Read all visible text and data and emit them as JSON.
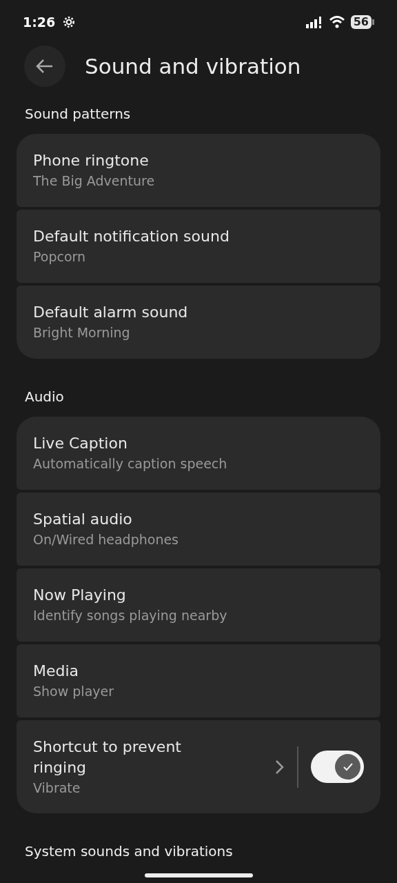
{
  "status_bar": {
    "time": "1:26",
    "battery": "56"
  },
  "header": {
    "title": "Sound and vibration"
  },
  "sections": [
    {
      "title": "Sound patterns",
      "items": [
        {
          "kind": "link",
          "title": "Phone ringtone",
          "subtitle": "The Big Adventure"
        },
        {
          "kind": "link",
          "title": "Default notification sound",
          "subtitle": "Popcorn"
        },
        {
          "kind": "link",
          "title": "Default alarm sound",
          "subtitle": "Bright Morning"
        }
      ]
    },
    {
      "title": "Audio",
      "items": [
        {
          "kind": "link",
          "title": "Live Caption",
          "subtitle": "Automatically caption speech"
        },
        {
          "kind": "link",
          "title": "Spatial audio",
          "subtitle": "On/Wired headphones"
        },
        {
          "kind": "link",
          "title": "Now Playing",
          "subtitle": "Identify songs playing nearby"
        },
        {
          "kind": "link",
          "title": "Media",
          "subtitle": "Show player"
        },
        {
          "kind": "toggle",
          "title": "Shortcut to prevent ringing",
          "subtitle": "Vibrate",
          "on": true
        }
      ]
    },
    {
      "title": "System sounds and vibrations"
    }
  ]
}
